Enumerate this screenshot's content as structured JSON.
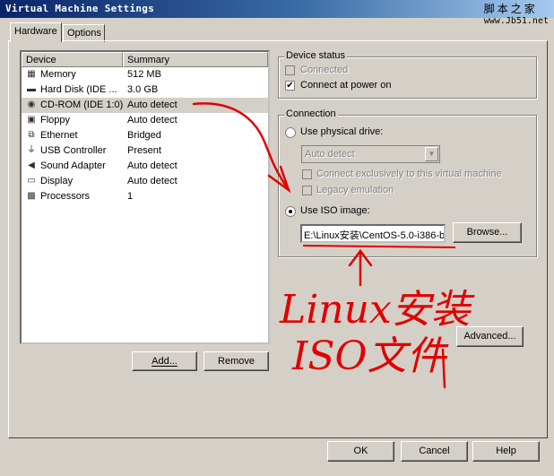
{
  "window": {
    "title": "Virtual Machine Settings"
  },
  "watermark": {
    "line1": "脚本之家",
    "line2": "www.Jb51.net"
  },
  "tabs": [
    {
      "label": "Hardware"
    },
    {
      "label": "Options"
    }
  ],
  "device_list": {
    "headers": {
      "device": "Device",
      "summary": "Summary"
    },
    "rows": [
      {
        "name": "Memory",
        "summary": "512 MB",
        "icon": "memory-icon"
      },
      {
        "name": "Hard Disk (IDE ...",
        "summary": "3.0 GB",
        "icon": "hard-disk-icon"
      },
      {
        "name": "CD-ROM (IDE 1:0)",
        "summary": "Auto detect",
        "icon": "cdrom-icon",
        "selected": true
      },
      {
        "name": "Floppy",
        "summary": "Auto detect",
        "icon": "floppy-icon"
      },
      {
        "name": "Ethernet",
        "summary": "Bridged",
        "icon": "network-icon"
      },
      {
        "name": "USB Controller",
        "summary": "Present",
        "icon": "usb-icon"
      },
      {
        "name": "Sound Adapter",
        "summary": "Auto detect",
        "icon": "speaker-icon"
      },
      {
        "name": "Display",
        "summary": "Auto detect",
        "icon": "monitor-icon"
      },
      {
        "name": "Processors",
        "summary": "1",
        "icon": "cpu-icon"
      }
    ]
  },
  "list_buttons": {
    "add": "Add...",
    "remove": "Remove"
  },
  "device_status": {
    "label": "Device status",
    "connected": {
      "label": "Connected",
      "checked": false,
      "enabled": false
    },
    "connect_at_power_on": {
      "label": "Connect at power on",
      "checked": true,
      "enabled": true
    }
  },
  "connection": {
    "label": "Connection",
    "use_physical_drive": {
      "label": "Use physical drive:",
      "selected": false
    },
    "drive_select": {
      "value": "Auto detect"
    },
    "connect_exclusively": {
      "label": "Connect exclusively to this virtual machine",
      "enabled": false
    },
    "legacy_emulation": {
      "label": "Legacy emulation",
      "enabled": false
    },
    "use_iso_image": {
      "label": "Use ISO image:",
      "selected": true
    },
    "iso_path": "E:\\Linux安装\\CentOS-5.0-i386-b",
    "browse": "Browse..."
  },
  "advanced": "Advanced...",
  "footer": {
    "ok": "OK",
    "cancel": "Cancel",
    "help": "Help"
  },
  "annotation": {
    "text_line1": "Linux安装",
    "text_line2": "ISO文件",
    "color": "#e00000"
  },
  "colors": {
    "titlebar_start": "#0a246a",
    "titlebar_end": "#a6caf0",
    "face": "#d4d0c8"
  }
}
